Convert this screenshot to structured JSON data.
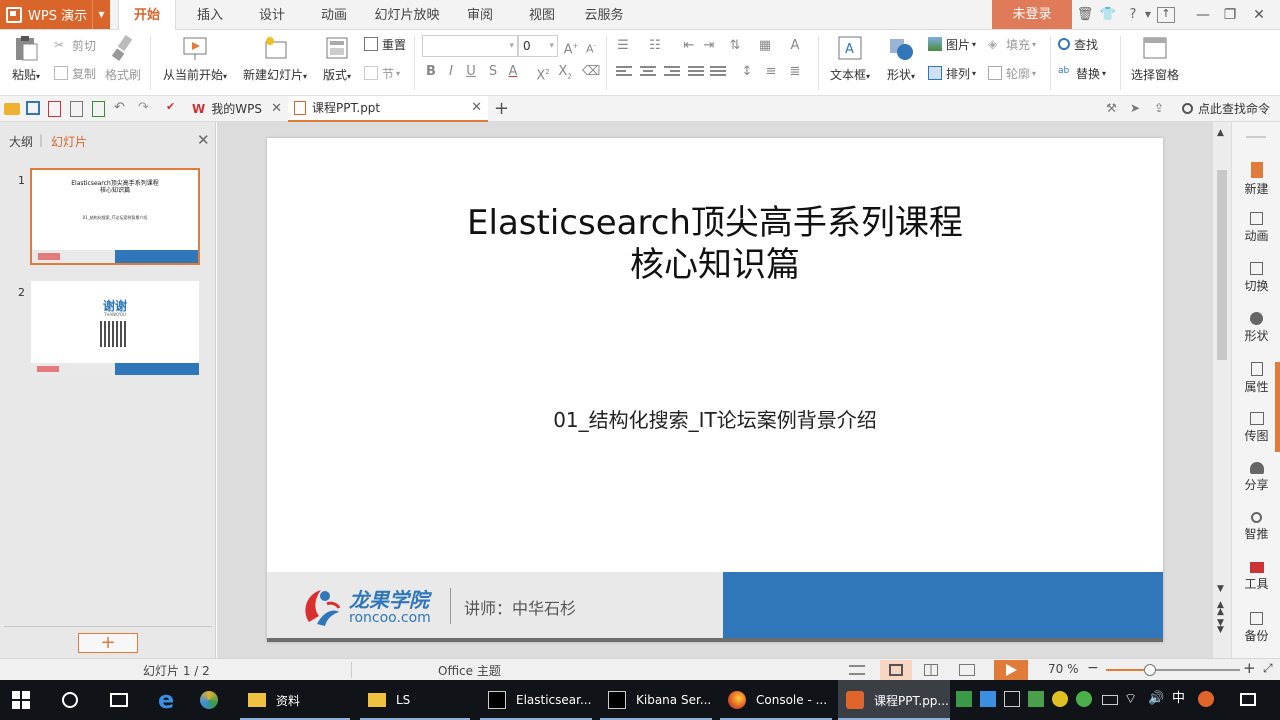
{
  "app": {
    "name": "WPS 演示",
    "login": "未登录"
  },
  "menu_tabs": [
    "开始",
    "插入",
    "设计",
    "动画",
    "幻灯片放映",
    "审阅",
    "视图",
    "云服务"
  ],
  "ribbon": {
    "paste": "粘贴",
    "cut": "剪切",
    "copy": "复制",
    "format_painter": "格式刷",
    "from_current": "从当前开始",
    "new_slide": "新建幻灯片",
    "layout": "版式",
    "reset": "重置",
    "section": "节",
    "font_size": "0",
    "textbox": "文本框",
    "shape": "形状",
    "picture": "图片",
    "fill": "填充",
    "arrange": "排列",
    "outline": "轮廓",
    "find": "查找",
    "replace": "替换",
    "select_pane": "选择窗格"
  },
  "doc_tabs": {
    "wps": "我的WPS",
    "file": "课程PPT.ppt"
  },
  "find_cmd": "点此查找命令",
  "panel": {
    "outline_tab": "大纲",
    "slides_tab": "幻灯片"
  },
  "thumbs": [
    {
      "num": "1"
    },
    {
      "num": "2",
      "thanks": "谢谢",
      "thanks_en": "THANKYOU"
    }
  ],
  "slide": {
    "title_line1": "Elasticsearch顶尖高手系列课程",
    "title_line2": "核心知识篇",
    "subtitle": "01_结构化搜索_IT论坛案例背景介绍",
    "logo_cn": "龙果学院",
    "logo_en": "roncoo.com",
    "lecturer": "讲师：中华石杉"
  },
  "right_rail": [
    "新建",
    "动画",
    "切换",
    "形状",
    "属性",
    "传图",
    "分享",
    "智推",
    "工具",
    "备份"
  ],
  "status": {
    "slide_count": "幻灯片 1 / 2",
    "theme": "Office 主题",
    "zoom": "70 %",
    "zoom_fraction": 0.33
  },
  "taskbar": {
    "items": [
      "资料",
      "LS",
      "Elasticsear...",
      "Kibana Ser...",
      "Console - ...",
      "课程PPT.pp..."
    ],
    "ime": "中"
  },
  "colors": {
    "accent": "#d9652b",
    "slide_blue": "#2f77b9",
    "taskbar": "#101418"
  }
}
